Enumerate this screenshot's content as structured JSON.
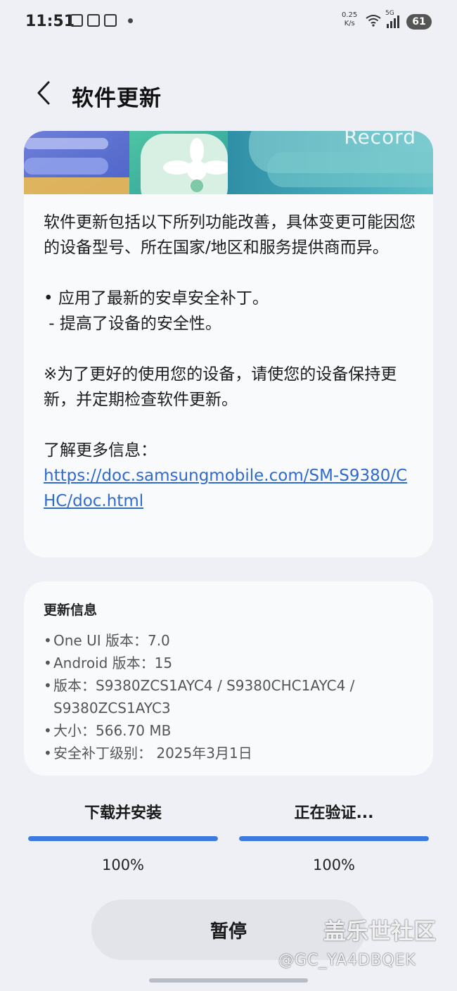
{
  "status_bar": {
    "time": "11:51",
    "net_speed_value": "0.25",
    "net_speed_unit": "K/s",
    "network_type": "5G",
    "battery": "61"
  },
  "header": {
    "title": "软件更新"
  },
  "release_notes": {
    "banner_text": "Record",
    "intro": "软件更新包括以下所列功能改善，具体变更可能因您的设备型号、所在国家/地区和服务提供商而异。",
    "item": "• 应用了最新的安卓安全补丁。",
    "sub_item": " - 提高了设备的安全性。",
    "note": "※为了更好的使用您的设备，请使您的设备保持更新，并定期检查软件更新。",
    "more_info_label": "了解更多信息：",
    "link": "https://doc.samsungmobile.com/SM-S9380/CHC/doc.html"
  },
  "update_info": {
    "title": "更新信息",
    "rows": [
      "One UI 版本：7.0",
      "Android 版本：15",
      "版本：S9380ZCS1AYC4 / S9380CHC1AYC4 / S9380ZCS1AYC3",
      "大小：566.70 MB",
      "安全补丁级别： 2025年3月1日"
    ]
  },
  "progress": {
    "download": {
      "label": "下载并安装",
      "percent_text": "100%",
      "value": 1.0
    },
    "verify": {
      "label": "正在验证...",
      "percent_text": "100%",
      "value": 1.0
    }
  },
  "actions": {
    "pause_label": "暂停"
  },
  "watermark": {
    "line1": "盖乐世社区",
    "line2": "@GC_YA4DBQEK"
  },
  "colors": {
    "accent": "#3d7ae0",
    "link": "#2f6ad0",
    "background": "#eef0f6"
  },
  "icons": {
    "back": "chevron-left-icon",
    "wifi": "wifi-icon",
    "signal": "signal-icon",
    "battery": "battery-icon"
  }
}
